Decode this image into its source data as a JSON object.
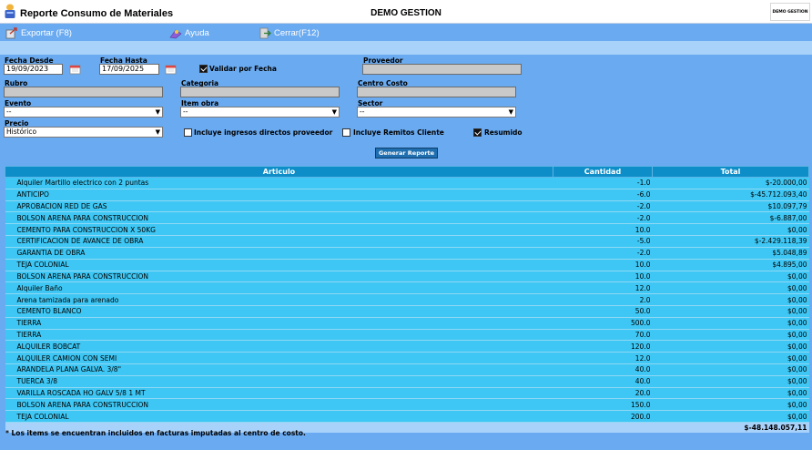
{
  "app": {
    "title": "Reporte Consumo de Materiales",
    "company": "DEMO GESTION",
    "logo_text": "DEMO GESTION"
  },
  "menu": [
    {
      "label": "Exportar (F8)",
      "icon": "export-icon"
    },
    {
      "label": "Ayuda",
      "icon": "help-icon"
    },
    {
      "label": "Cerrar(F12)",
      "icon": "close-icon"
    }
  ],
  "filters": {
    "fecha_desde": {
      "label": "Fecha Desde",
      "value": "19/09/2023"
    },
    "fecha_hasta": {
      "label": "Fecha Hasta",
      "value": "17/09/2025"
    },
    "validar_por_fecha": {
      "label": "Validar por Fecha",
      "checked": true
    },
    "proveedor": {
      "label": "Proveedor",
      "value": ""
    },
    "rubro": {
      "label": "Rubro",
      "value": ""
    },
    "categoria": {
      "label": "Categoria",
      "value": ""
    },
    "centro_costo": {
      "label": "Centro Costo",
      "value": ""
    },
    "evento": {
      "label": "Evento",
      "value": "--"
    },
    "item_obra": {
      "label": "Item obra",
      "value": "--"
    },
    "sector": {
      "label": "Sector",
      "value": "--"
    },
    "precio": {
      "label": "Precio",
      "value": "Histórico"
    },
    "incluye_ingresos": {
      "label": "Incluye ingresos directos proveedor",
      "checked": false
    },
    "incluye_remitos": {
      "label": "Incluye Remitos Cliente",
      "checked": false
    },
    "resumido": {
      "label": "Resumido",
      "checked": true
    },
    "generar_label": "Generar Reporte"
  },
  "table": {
    "headers": [
      "Articulo",
      "Cantidad",
      "Total"
    ],
    "rows": [
      [
        "Alquiler Martillo electrico con 2 puntas",
        "-1.0",
        "$-20.000,00"
      ],
      [
        "ANTICIPO",
        "-6.0",
        "$-45.712.093,40"
      ],
      [
        "APROBACION RED DE GAS",
        "-2.0",
        "$10.097,79"
      ],
      [
        "BOLSON ARENA PARA CONSTRUCCION",
        "-2.0",
        "$-6.887,00"
      ],
      [
        "CEMENTO PARA CONSTRUCCION X 50KG",
        "10.0",
        "$0,00"
      ],
      [
        "CERTIFICACION DE AVANCE DE OBRA",
        "-5.0",
        "$-2.429.118,39"
      ],
      [
        "GARANTIA DE OBRA",
        "-2.0",
        "$5.048,89"
      ],
      [
        "TEJA COLONIAL",
        "10.0",
        "$4.895,00"
      ],
      [
        "BOLSON ARENA PARA CONSTRUCCION",
        "10.0",
        "$0,00"
      ],
      [
        "Alquiler Baño",
        "12.0",
        "$0,00"
      ],
      [
        "Arena tamizada para arenado",
        "2.0",
        "$0,00"
      ],
      [
        "CEMENTO BLANCO",
        "50.0",
        "$0,00"
      ],
      [
        "TIERRA",
        "500.0",
        "$0,00"
      ],
      [
        "TIERRA",
        "70.0",
        "$0,00"
      ],
      [
        "ALQUILER BOBCAT",
        "120.0",
        "$0,00"
      ],
      [
        "ALQUILER CAMION CON SEMI",
        "12.0",
        "$0,00"
      ],
      [
        "ARANDELA PLANA GALVA. 3/8\"",
        "40.0",
        "$0,00"
      ],
      [
        "TUERCA 3/8",
        "40.0",
        "$0,00"
      ],
      [
        "VARILLA ROSCADA HO GALV  5/8  1 MT",
        "20.0",
        "$0,00"
      ],
      [
        "BOLSON ARENA PARA CONSTRUCCION",
        "150.0",
        "$0,00"
      ],
      [
        "TEJA COLONIAL",
        "200.0",
        "$0,00"
      ]
    ],
    "total": "$-48.148.057,11"
  },
  "footnote": "* Los items se encuentran incluidos en facturas imputadas al centro de costo.",
  "colors": {
    "background": "#6aaaf0",
    "header": "#0d8ec8",
    "row": "#3ec7f4",
    "strip": "#a9d2fb",
    "button": "#1f6fb0"
  }
}
